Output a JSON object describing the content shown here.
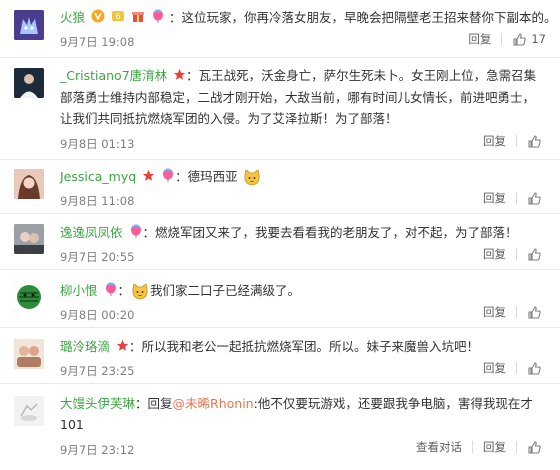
{
  "comments": [
    {
      "user": "火狼",
      "text": "：这位玩家，你再冷落女朋友，早晚会把隔壁老王招来替你下副本的。",
      "time": "9月7日 19:08",
      "reply": "回复",
      "likes": "17",
      "avatar_color": "#4a3d8f"
    },
    {
      "user": "_Cristiano7唐淯林",
      "text": "：瓦王战死，沃金身亡，萨尔生死未卜。女王刚上位，急需召集部落勇士维持内部稳定，二战才刚开始，大敌当前，哪有时间儿女情长，前进吧勇士，让我们共同抵抗燃烧军团的入侵。为了艾泽拉斯！为了部落！",
      "time": "9月8日 01:13",
      "reply": "回复",
      "avatar_color": "#1c2a3a"
    },
    {
      "user": "Jessica_myq",
      "text": "：德玛西亚",
      "time": "9月8日 11:08",
      "reply": "回复",
      "avatar_color": "#c98a7a"
    },
    {
      "user": "逸逸凤凤依",
      "text": "：燃烧军团又来了，我要去看看我的老朋友了，对不起，为了部落！",
      "time": "9月7日 20:55",
      "reply": "回复",
      "avatar_color": "#6d6e72"
    },
    {
      "user": "柳小恨",
      "text": "我们家二口子已经满级了。",
      "time": "9月8日 00:20",
      "reply": "回复",
      "avatar_color": "#2f7a2f"
    },
    {
      "user": "璐泠珞滴",
      "text": "：所以我和老公一起抵抗燃烧军团。所以。妹子来魔兽入坑吧！",
      "time": "9月7日 23:25",
      "reply": "回复",
      "avatar_color": "#b07c64"
    },
    {
      "user": "大馒头伊芙琳",
      "prefix": "：回复",
      "mention": "@未晞Rhonin",
      "text": ":他不仅要玩游戏，还要跟我争电脑，害得我现在才101",
      "time": "9月7日 23:12",
      "view_conversation": "查看对话",
      "reply": "回复",
      "avatar_color": "#e8e8e8"
    }
  ]
}
